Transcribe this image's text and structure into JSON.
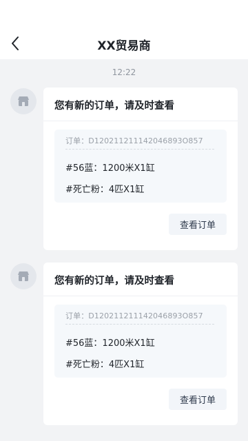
{
  "header": {
    "title": "XX贸易商",
    "back_icon": "chevron-left-icon"
  },
  "feed": {
    "time": "12:22",
    "messages": [
      {
        "avatar_icon": "store-icon",
        "title": "您有新的订单，请及时查看",
        "order_id": "订单：D120211211142046893O857",
        "items": [
          "#56蓝：1200米X1缸",
          "#死亡粉：4匹X1缸"
        ],
        "button_label": "查看订单"
      },
      {
        "avatar_icon": "store-icon",
        "title": "您有新的订单，请及时查看",
        "order_id": "订单：D120211211142046893O857",
        "items": [
          "#56蓝：1200米X1缸",
          "#死亡粉：4匹X1缸"
        ],
        "button_label": "查看订单"
      }
    ]
  }
}
